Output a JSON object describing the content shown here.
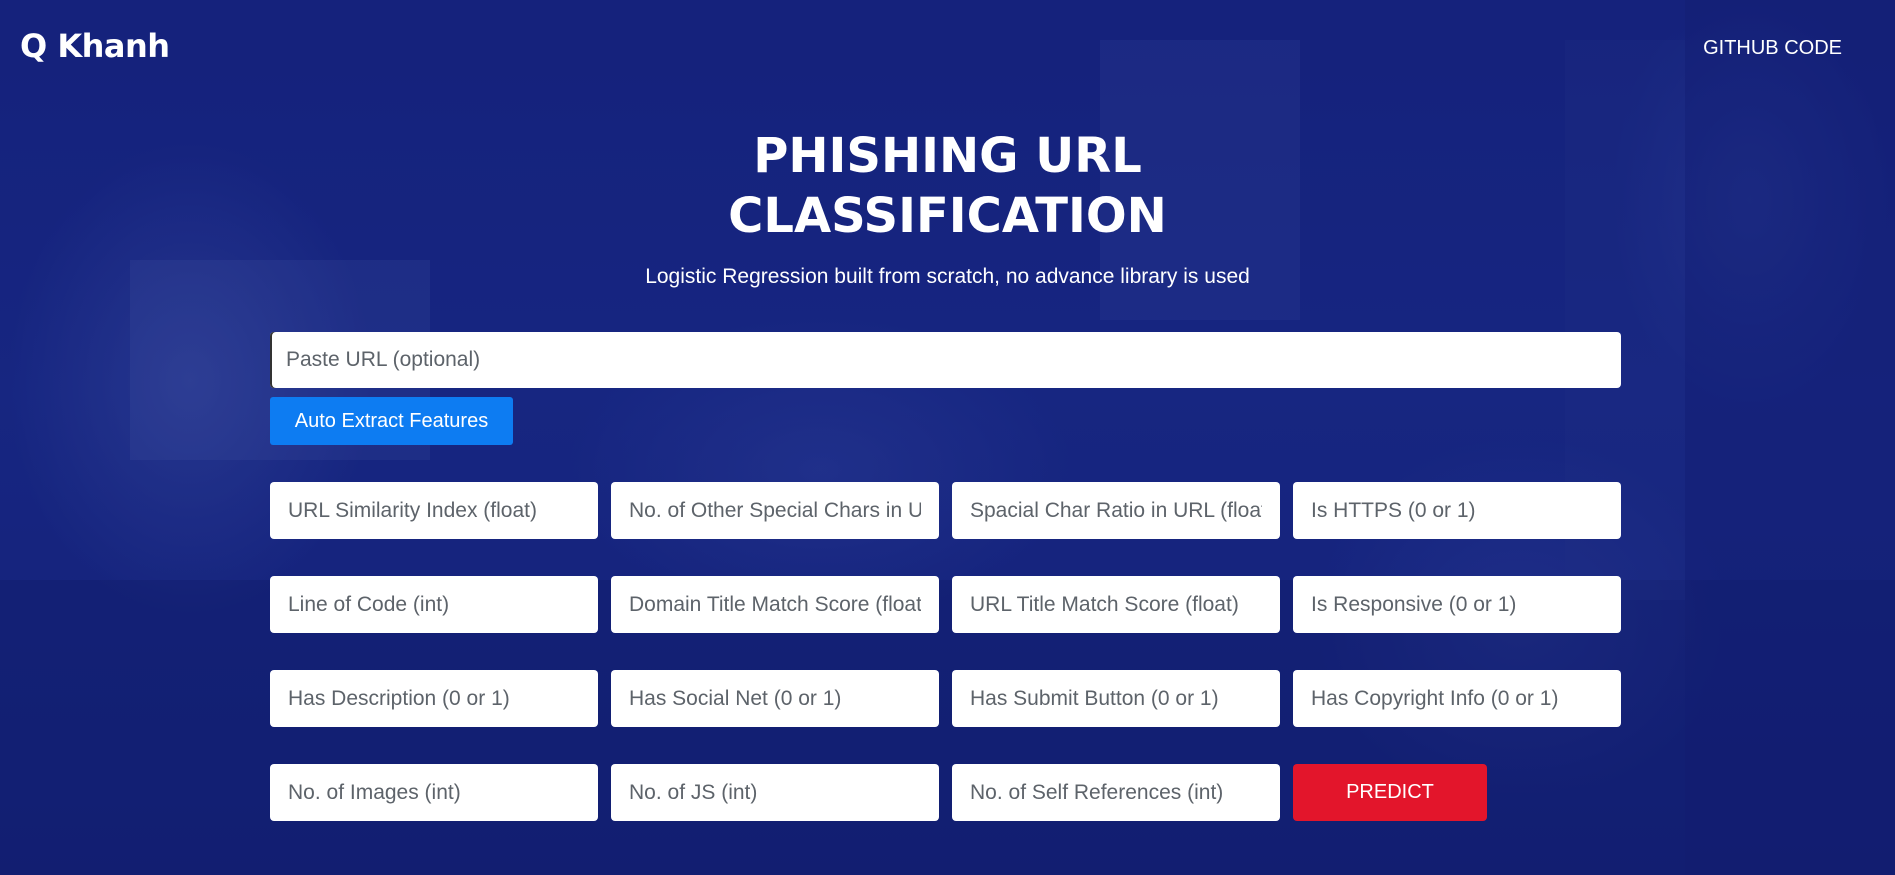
{
  "header": {
    "logo_text": "Q Khanh",
    "nav_github": "GITHUB CODE"
  },
  "hero": {
    "title_line1": "PHISHING URL",
    "title_line2": "CLASSIFICATION",
    "subtitle": "Logistic Regression built from scratch, no advance library is used"
  },
  "url_field": {
    "placeholder": "Paste URL (optional)",
    "value": ""
  },
  "extract_button": {
    "label": "Auto Extract Features"
  },
  "features": [
    {
      "placeholder": "URL Similarity Index (float)"
    },
    {
      "placeholder": "No. of Other Special Chars in URL (int)"
    },
    {
      "placeholder": "Spacial Char Ratio in URL (float)"
    },
    {
      "placeholder": "Is HTTPS (0 or 1)"
    },
    {
      "placeholder": "Line of Code (int)"
    },
    {
      "placeholder": "Domain Title Match Score (float)"
    },
    {
      "placeholder": "URL Title Match Score (float)"
    },
    {
      "placeholder": "Is Responsive (0 or 1)"
    },
    {
      "placeholder": "Has Description (0 or 1)"
    },
    {
      "placeholder": "Has Social Net (0 or 1)"
    },
    {
      "placeholder": "Has Submit Button (0 or 1)"
    },
    {
      "placeholder": "Has Copyright Info (0 or 1)"
    },
    {
      "placeholder": "No. of Images (int)"
    },
    {
      "placeholder": "No. of JS (int)"
    },
    {
      "placeholder": "No. of Self References (int)"
    }
  ],
  "predict_button": {
    "label": "PREDICT"
  },
  "colors": {
    "background": "#16237a",
    "extract_button": "#0d7cf2",
    "predict_button": "#e3152b",
    "text": "#ffffff"
  }
}
